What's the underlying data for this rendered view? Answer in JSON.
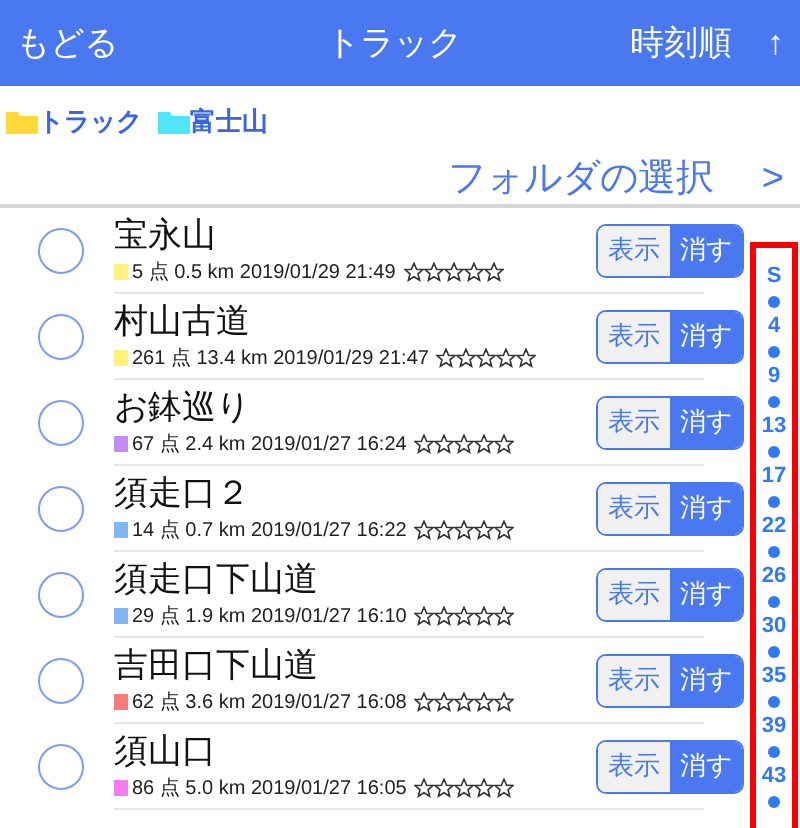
{
  "header": {
    "back": "もどる",
    "title": "トラック",
    "sort": "時刻順",
    "sort_arrow": "↑"
  },
  "breadcrumb": [
    {
      "label": "トラック",
      "color": "#ffd83a"
    },
    {
      "label": "富士山",
      "color": "#4fe6f5"
    }
  ],
  "folder_select": {
    "label": "フォルダの選択",
    "arrow": ">"
  },
  "tracks": [
    {
      "name": "宝永山",
      "color": "#fff27a",
      "meta": "5 点 0.5 km 2019/01/29 21:49",
      "stars": 0,
      "show": "表示",
      "hide": "消す",
      "hidden": true,
      "checked": false
    },
    {
      "name": "村山古道",
      "color": "#fff27a",
      "meta": "261 点 13.4 km 2019/01/29 21:47",
      "stars": 0,
      "show": "表示",
      "hide": "消す",
      "hidden": true,
      "checked": false
    },
    {
      "name": "お鉢巡り",
      "color": "#c58cf5",
      "meta": "67 点 2.4 km 2019/01/27 16:24",
      "stars": 0,
      "show": "表示",
      "hide": "消す",
      "hidden": true,
      "checked": false
    },
    {
      "name": "須走口２",
      "color": "#7fb8f5",
      "meta": "14 点 0.7 km 2019/01/27 16:22",
      "stars": 0,
      "show": "表示",
      "hide": "消す",
      "hidden": true,
      "checked": false
    },
    {
      "name": "須走口下山道",
      "color": "#7fb8f5",
      "meta": "29 点 1.9 km 2019/01/27 16:10",
      "stars": 0,
      "show": "表示",
      "hide": "消す",
      "hidden": true,
      "checked": false
    },
    {
      "name": "吉田口下山道",
      "color": "#f77b7b",
      "meta": "62 点 3.6 km 2019/01/27 16:08",
      "stars": 0,
      "show": "表示",
      "hide": "消す",
      "hidden": true,
      "checked": false
    },
    {
      "name": "須山口",
      "color": "#f77bf0",
      "meta": "86 点 5.0 km 2019/01/27 16:05",
      "stars": 0,
      "show": "表示",
      "hide": "消す",
      "hidden": true,
      "checked": false
    }
  ],
  "index_bar": [
    "S",
    "4",
    "9",
    "13",
    "17",
    "22",
    "26",
    "30",
    "35",
    "39",
    "43"
  ]
}
